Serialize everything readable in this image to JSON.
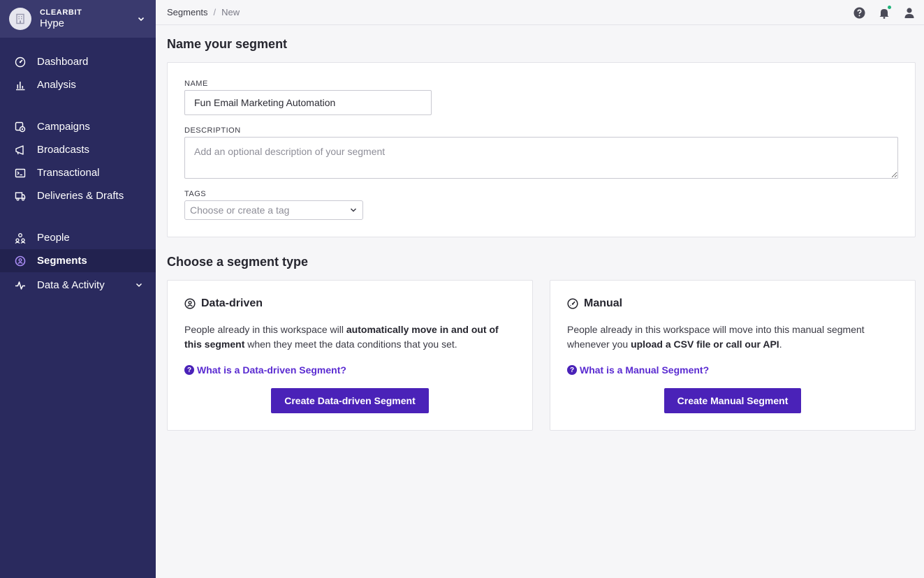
{
  "workspace": {
    "org": "CLEARBIT",
    "name": "Hype"
  },
  "sidebar": {
    "groups": [
      [
        {
          "label": "Dashboard",
          "icon": "gauge-icon"
        },
        {
          "label": "Analysis",
          "icon": "bar-chart-icon"
        }
      ],
      [
        {
          "label": "Campaigns",
          "icon": "campaigns-icon"
        },
        {
          "label": "Broadcasts",
          "icon": "megaphone-icon"
        },
        {
          "label": "Transactional",
          "icon": "terminal-icon"
        },
        {
          "label": "Deliveries & Drafts",
          "icon": "deliveries-icon"
        }
      ],
      [
        {
          "label": "People",
          "icon": "people-icon"
        },
        {
          "label": "Segments",
          "icon": "segments-icon",
          "active": true
        },
        {
          "label": "Data & Activity",
          "icon": "activity-icon",
          "expandable": true
        }
      ]
    ]
  },
  "breadcrumb": {
    "parent": "Segments",
    "separator": "/",
    "current": "New"
  },
  "top_icons": [
    "help-icon",
    "bell-icon",
    "user-icon"
  ],
  "name_section": {
    "heading": "Name your segment",
    "name_label": "NAME",
    "name_value": "Fun Email Marketing Automation",
    "description_label": "DESCRIPTION",
    "description_placeholder": "Add an optional description of your segment",
    "tags_label": "TAGS",
    "tags_placeholder": "Choose or create a tag"
  },
  "type_section": {
    "heading": "Choose a segment type",
    "data_driven": {
      "title": "Data-driven",
      "desc_1": "People already in this workspace will ",
      "desc_bold_1": "automatically move in and out of this segment",
      "desc_2": " when they meet the data conditions that you set.",
      "link": "What is a Data-driven Segment?",
      "button": "Create Data-driven Segment"
    },
    "manual": {
      "title": "Manual",
      "desc_1": "People already in this workspace will move into this manual segment whenever you ",
      "desc_bold_1": "upload a CSV file or call our API",
      "desc_2": ".",
      "link": "What is a Manual Segment?",
      "button": "Create Manual Segment"
    }
  },
  "colors": {
    "sidebar_bg": "#2a2a5e",
    "sidebar_active": "#22224f",
    "accent": "#4a22b8",
    "link": "#5a2bd1",
    "notification_dot": "#1fb37a"
  }
}
